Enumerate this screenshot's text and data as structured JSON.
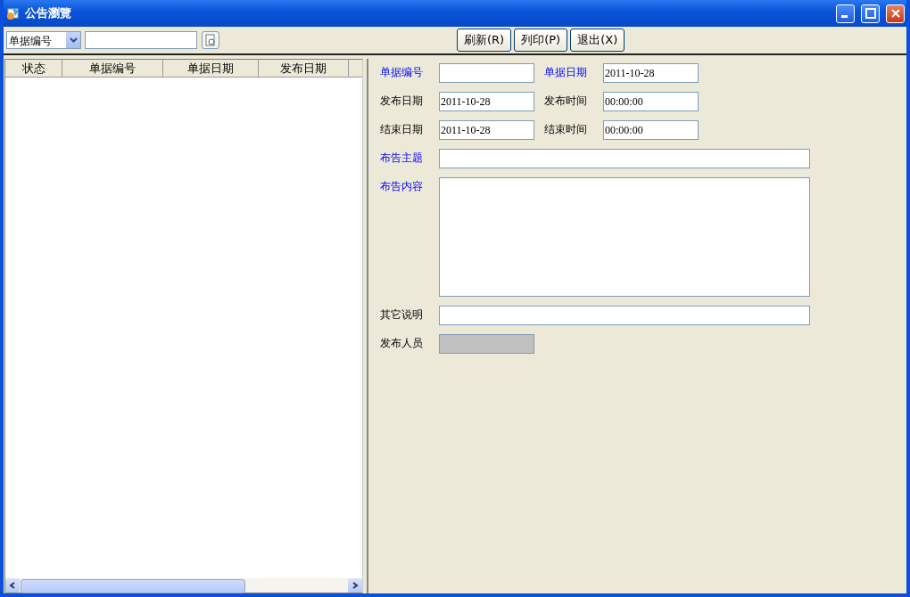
{
  "window": {
    "title": "公告瀏覽"
  },
  "toolbar": {
    "search_field": {
      "value": "单据编号"
    },
    "buttons": [
      "刷新(R)",
      "列印(P)",
      "退出(X)"
    ]
  },
  "list": {
    "columns": [
      "状态",
      "单据编号",
      "单据日期",
      "发布日期"
    ]
  },
  "form": {
    "rows": [
      [
        {
          "label": "单据编号",
          "required": true,
          "disabled": false,
          "kind": "short"
        },
        {
          "label": "单据日期",
          "value": "2011-10-28",
          "required": true,
          "disabled": false,
          "kind": "short"
        }
      ],
      [
        {
          "label": "发布日期",
          "value": "2011-10-28",
          "required": false,
          "disabled": false,
          "kind": "short"
        },
        {
          "label": "发布时间",
          "value": "00:00:00",
          "required": false,
          "disabled": false,
          "kind": "short"
        }
      ],
      [
        {
          "label": "结束日期",
          "value": "2011-10-28",
          "required": false,
          "disabled": false,
          "kind": "short"
        },
        {
          "label": "结束时间",
          "value": "00:00:00",
          "required": false,
          "disabled": false,
          "kind": "short"
        }
      ],
      [
        {
          "label": "布告主题",
          "required": true,
          "disabled": false,
          "kind": "wide"
        }
      ],
      [
        {
          "label": "布告内容",
          "required": true,
          "disabled": false,
          "kind": "area"
        }
      ],
      [
        {
          "label": "其它说明",
          "required": false,
          "disabled": false,
          "kind": "wide"
        }
      ],
      [
        {
          "label": "发布人员",
          "required": false,
          "disabled": true,
          "kind": "short"
        }
      ]
    ]
  }
}
